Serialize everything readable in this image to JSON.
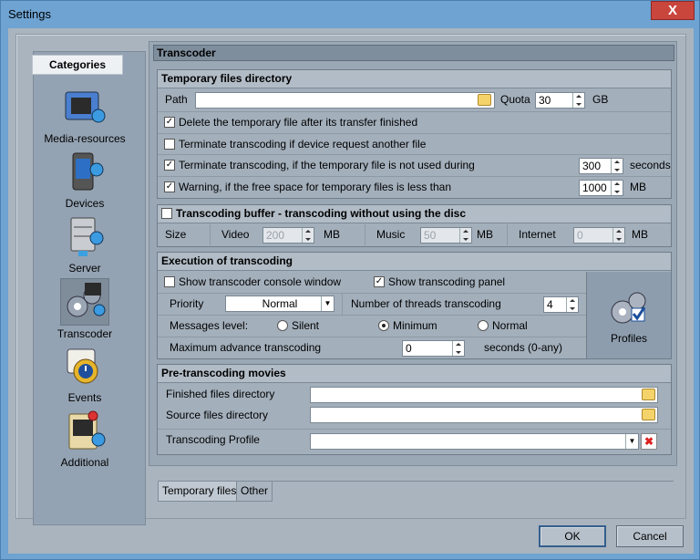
{
  "window": {
    "title": "Settings",
    "close_label": "X"
  },
  "categories": {
    "header": "Categories",
    "items": [
      {
        "label": "Media-resources",
        "icon": "media-resources-icon"
      },
      {
        "label": "Devices",
        "icon": "devices-icon"
      },
      {
        "label": "Server",
        "icon": "server-icon"
      },
      {
        "label": "Transcoder",
        "icon": "transcoder-icon",
        "selected": true
      },
      {
        "label": "Events",
        "icon": "events-icon"
      },
      {
        "label": "Additional",
        "icon": "additional-icon"
      }
    ]
  },
  "panel": {
    "title": "Transcoder"
  },
  "temp": {
    "title": "Temporary files directory",
    "path_label": "Path",
    "path_value": "",
    "quota_label": "Quota",
    "quota_value": "30",
    "quota_unit": "GB",
    "delete_label": "Delete the temporary file after its transfer finished",
    "delete_checked": true,
    "terminate_req_label": "Terminate transcoding if device request another file",
    "terminate_req_checked": false,
    "terminate_unused_label": "Terminate transcoding, if the temporary file is not used during",
    "terminate_unused_checked": true,
    "terminate_unused_value": "300",
    "terminate_unused_unit": "seconds",
    "warning_label": "Warning, if the free space for temporary files is less than",
    "warning_checked": true,
    "warning_value": "1000",
    "warning_unit": "MB"
  },
  "buffer": {
    "title": "Transcoding buffer  - transcoding without using the disc",
    "checked": false,
    "size_label": "Size",
    "video_label": "Video",
    "video_value": "200",
    "music_label": "Music",
    "music_value": "50",
    "internet_label": "Internet",
    "internet_value": "0",
    "unit": "MB"
  },
  "execution": {
    "title": "Execution of transcoding",
    "console_label": "Show transcoder console window",
    "console_checked": false,
    "panel_label": "Show transcoding panel",
    "panel_checked": true,
    "priority_label": "Priority",
    "priority_value": "Normal",
    "threads_label": "Number of threads transcoding",
    "threads_value": "4",
    "messages_label": "Messages level:",
    "radio_silent": "Silent",
    "radio_minimum": "Minimum",
    "radio_normal": "Normal",
    "selected_level": "Minimum",
    "max_advance_label": "Maximum advance transcoding",
    "max_advance_value": "0",
    "max_advance_unit": "seconds (0-any)",
    "profiles_label": "Profiles"
  },
  "pre": {
    "title": "Pre-transcoding movies",
    "finished_label": "Finished files directory",
    "finished_value": "",
    "source_label": "Source files directory",
    "source_value": "",
    "profile_label": "Transcoding Profile",
    "profile_value": ""
  },
  "tabs": [
    "Temporary files",
    "Other"
  ],
  "buttons": {
    "ok": "OK",
    "cancel": "Cancel"
  }
}
